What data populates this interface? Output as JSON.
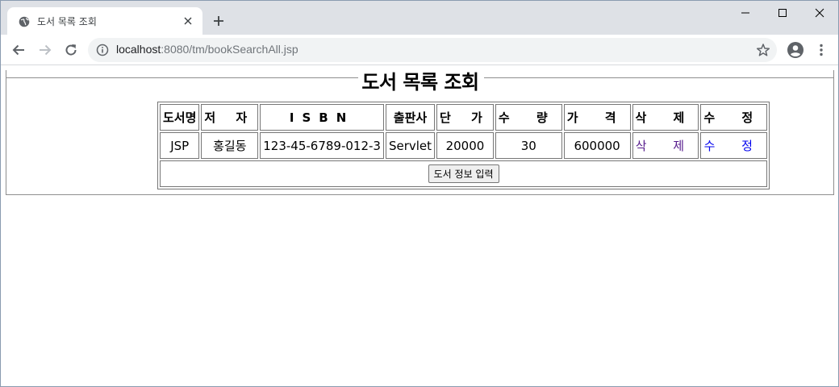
{
  "browser": {
    "tab": {
      "title": "도서 목록 조회",
      "favicon": "globe-icon"
    },
    "url": {
      "host": "localhost",
      "rest": ":8080/tm/bookSearchAll.jsp"
    }
  },
  "page": {
    "legend": "도서 목록 조회",
    "table": {
      "headers": [
        "도서명",
        "저 자",
        "ISBN",
        "출판사",
        "단 가",
        "수 량",
        "가 격",
        "삭 제",
        "수 정"
      ],
      "rows": [
        {
          "title": "JSP",
          "author": "홍길동",
          "isbn": "123-45-6789-012-3",
          "publisher": "Servlet",
          "unit_price": "20000",
          "quantity": "30",
          "price": "600000",
          "delete_link": "삭 제",
          "edit_link": "수 정"
        }
      ],
      "insert_button": "도서 정보 입력"
    }
  },
  "colors": {
    "visited_link": "#551a8b",
    "link": "#0000ee",
    "tabstrip": "#dee1e6"
  }
}
